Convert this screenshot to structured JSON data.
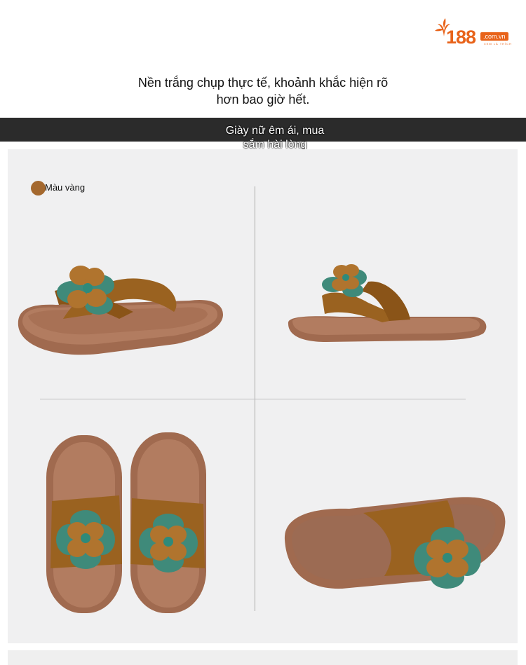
{
  "brand": {
    "number": "188",
    "domain": ".com.vn",
    "tagline": "XEM LÀ THÍCH",
    "color": "#e8631a"
  },
  "intro": {
    "line1": "Nền trắng chụp thực tế, khoảnh khắc hiện rõ",
    "line2": "hơn bao giờ hết."
  },
  "banner": {
    "line1": "Giày nữ êm ái, mua",
    "line2": "sắm hài lòng"
  },
  "color_option": {
    "label": "Màu vàng",
    "swatch": "#a4682e"
  },
  "photos": [
    "side-view",
    "side-view-right",
    "top-view-pair",
    "sole-view"
  ],
  "colors": {
    "leather": "#9a6220",
    "sole": "#a87155",
    "petal_green": "#3f8a7a",
    "petal_brown": "#b0742e"
  }
}
